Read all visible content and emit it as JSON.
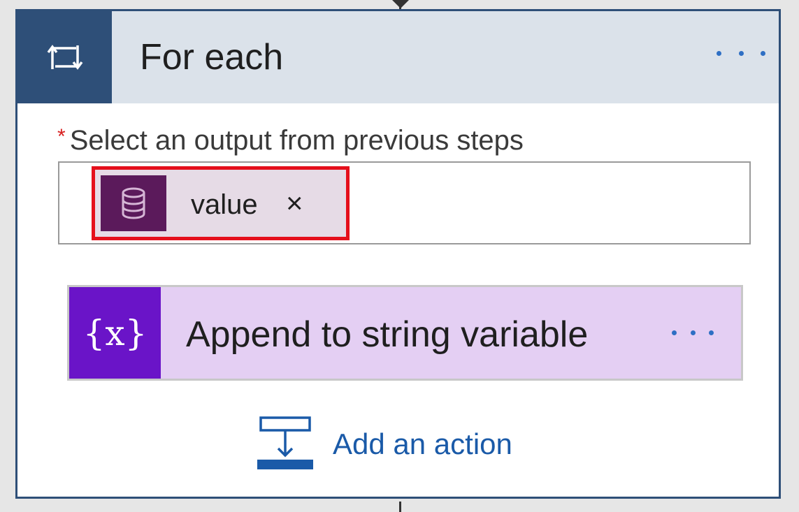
{
  "card": {
    "title": "For each",
    "icon": "loop-icon",
    "menu_icon": "ellipsis-icon",
    "header_color": "#2e4f78"
  },
  "field": {
    "required_mark": "*",
    "label": "Select an output from previous steps",
    "token": {
      "label": "value",
      "icon": "database-icon",
      "remove_glyph": "×",
      "highlight_color": "#e5101c"
    }
  },
  "action": {
    "icon_text": "{x}",
    "icon": "variable-icon",
    "title": "Append to string variable",
    "menu_icon": "ellipsis-icon",
    "accent_color": "#6a14c8"
  },
  "add_action": {
    "label": "Add an action",
    "icon": "add-action-icon",
    "color": "#1a5aa8"
  }
}
